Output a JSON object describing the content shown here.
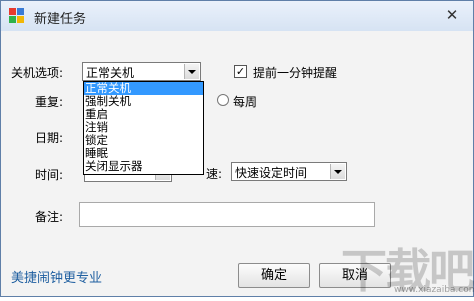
{
  "window": {
    "title": "新建任务",
    "close_glyph": "✕"
  },
  "options_label": "关机选项:",
  "action_combo": {
    "value": "正常关机"
  },
  "remind_checkbox": {
    "checked": true,
    "mark": "✓",
    "label": "提前一分钟提醒"
  },
  "dropdown": {
    "options": [
      "正常关机",
      "强制关机",
      "重启",
      "注销",
      "锁定",
      "睡眠",
      "关闭显示器"
    ],
    "selected_index": 0
  },
  "repeat": {
    "label": "重复:",
    "weekly_label": "每周"
  },
  "date": {
    "label": "日期:"
  },
  "time": {
    "label": "时间:"
  },
  "quick": {
    "label_partial": "速:",
    "value": "快速设定时间"
  },
  "note": {
    "label": "备注:",
    "value": ""
  },
  "footer": {
    "promo_link": "美捷闹钟更专业",
    "ok_label": "确定",
    "cancel_label": "取消"
  },
  "watermark": {
    "text": "下载吧",
    "sub": "www.xiazaiba.com"
  },
  "colors": {
    "accent": "#3399ff",
    "link": "#1f5fa0",
    "icon": [
      "#e63a2e",
      "#3a7bd5",
      "#2fb24a",
      "#f2b705"
    ]
  }
}
